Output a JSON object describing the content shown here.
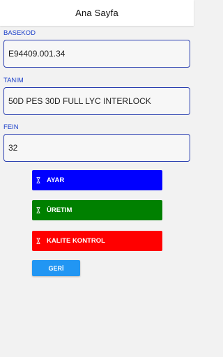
{
  "header": {
    "title": "Ana Sayfa"
  },
  "fields": {
    "basekod": {
      "label": "BASEKOD",
      "value": "E94409.001.34"
    },
    "tanim": {
      "label": "TANIM",
      "value": "50D PES 30D FULL LYC INTERLOCK"
    },
    "fein": {
      "label": "FEIN",
      "value": "32"
    }
  },
  "actions": {
    "ayar": {
      "label": "AYAR",
      "color": "#0000ff",
      "icon": "hourglass-icon"
    },
    "uretim": {
      "label": "ÜRETIM",
      "color": "#008000",
      "icon": "hourglass-icon"
    },
    "kalite": {
      "label": "KALITE KONTROL",
      "color": "#ff0000",
      "icon": "hourglass-icon"
    }
  },
  "back": {
    "label": "GERİ",
    "color": "#2196f3"
  },
  "colors": {
    "accent": "#1a3fc9",
    "field_border": "#2a3fb0",
    "background": "#f2f2f2"
  }
}
